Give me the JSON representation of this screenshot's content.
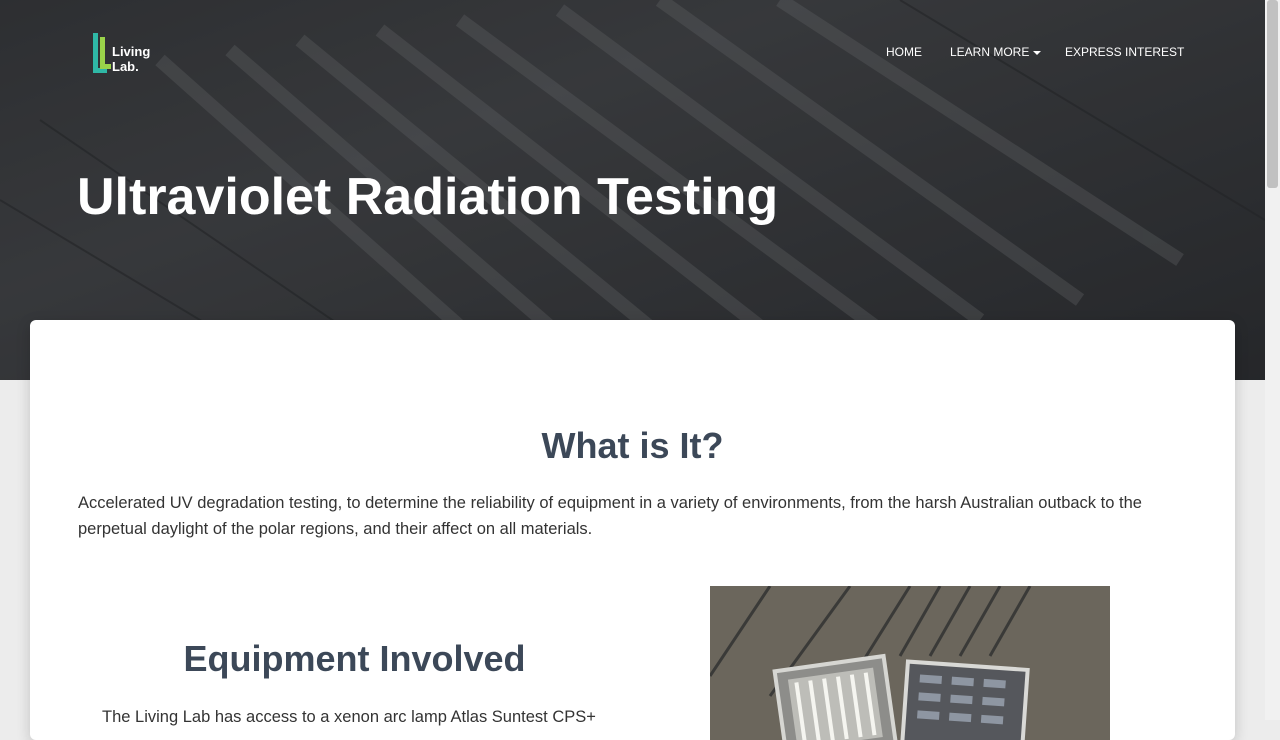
{
  "brand": {
    "logo_text": "Living Lab."
  },
  "nav": {
    "items": [
      {
        "label": "HOME"
      },
      {
        "label": "LEARN MORE"
      },
      {
        "label": "EXPRESS INTEREST"
      }
    ]
  },
  "hero": {
    "title": "Ultraviolet Radiation Testing"
  },
  "what_is_it": {
    "title": "What is It?",
    "body": "Accelerated UV degradation testing, to determine the reliability of equipment in a variety of environments, from the harsh Australian outback to the perpetual daylight of the polar regions, and their affect on all materials."
  },
  "equipment": {
    "title": "Equipment Involved",
    "body": "The Living Lab has access to a xenon arc lamp Atlas Suntest CPS+"
  },
  "colors": {
    "heading": "#3c4858",
    "logo_teal": "#2fb8a6",
    "logo_green": "#9ad34a"
  }
}
